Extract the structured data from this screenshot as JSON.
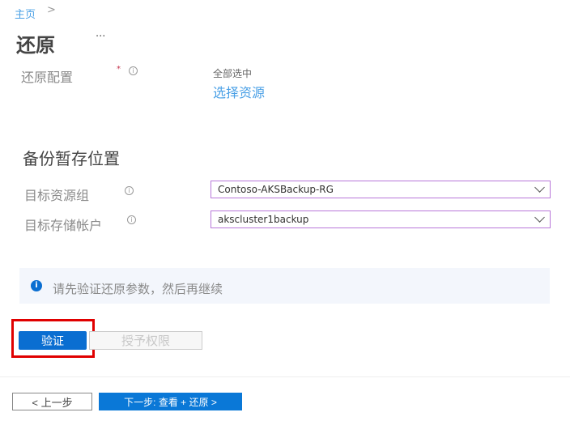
{
  "breadcrumb": {
    "home": "主页",
    "separator": ">"
  },
  "page": {
    "title": "还原",
    "more": "···"
  },
  "restore_config": {
    "label": "还原配置",
    "required_mark": "*",
    "selection_status": "全部选中",
    "select_link": "选择资源"
  },
  "staging": {
    "heading": "备份暂存位置",
    "resource_group": {
      "label": "目标资源组",
      "value": "Contoso-AKSBackup-RG"
    },
    "storage_account": {
      "label": "目标存储帐户",
      "value": "akscluster1backup"
    }
  },
  "banner": {
    "text": "请先验证还原参数，然后再继续"
  },
  "actions": {
    "validate": "验证",
    "grant": "授予权限"
  },
  "footer": {
    "prev": "< 上一步",
    "next": "下一步: 查看 + 还原 >"
  },
  "colors": {
    "accent": "#0a6ed1",
    "highlight": "#e00000"
  }
}
